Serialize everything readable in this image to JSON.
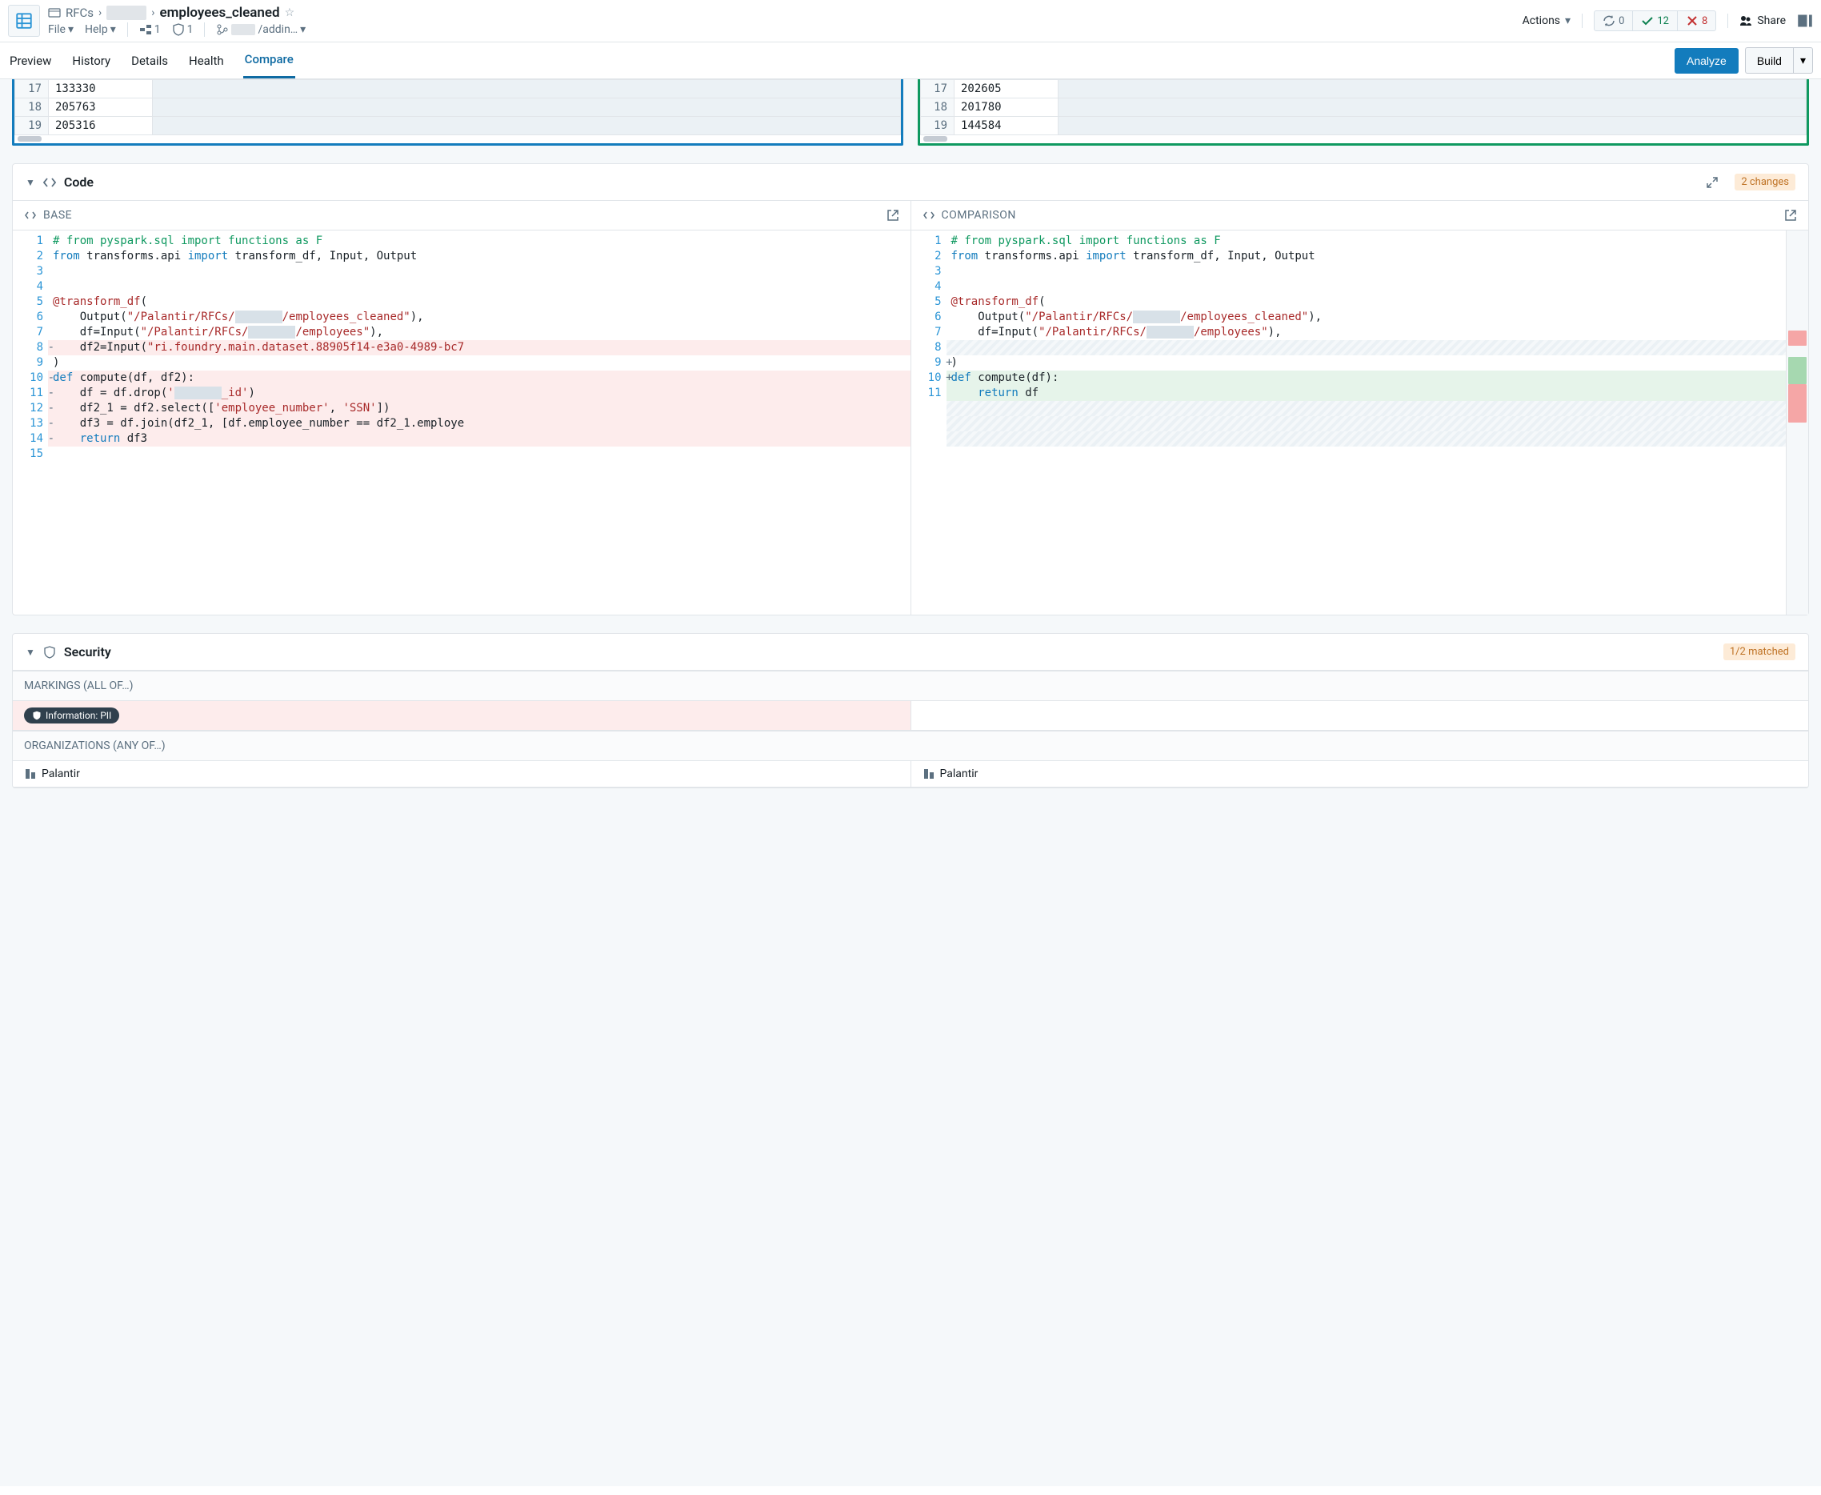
{
  "breadcrumb": {
    "root": "RFCs",
    "title": "employees_cleaned"
  },
  "menu": {
    "file": "File",
    "help": "Help",
    "branches": "1",
    "shield": "1",
    "path": "/addin…"
  },
  "actions_label": "Actions",
  "status": {
    "sync": "0",
    "pass": "12",
    "fail": "8"
  },
  "share": "Share",
  "tabs": {
    "preview": "Preview",
    "history": "History",
    "details": "Details",
    "health": "Health",
    "compare": "Compare"
  },
  "buttons": {
    "analyze": "Analyze",
    "build": "Build"
  },
  "left_table": [
    {
      "n": "17",
      "v": "133330"
    },
    {
      "n": "18",
      "v": "205763"
    },
    {
      "n": "19",
      "v": "205316"
    }
  ],
  "right_table": [
    {
      "n": "17",
      "v": "202605"
    },
    {
      "n": "18",
      "v": "201780"
    },
    {
      "n": "19",
      "v": "144584"
    }
  ],
  "code_card": {
    "title": "Code",
    "badge": "2 changes",
    "base": "BASE",
    "comparison": "COMPARISON"
  },
  "base_gutter": [
    "1",
    "2",
    "3",
    "4",
    "5",
    "6",
    "7",
    "8",
    "9",
    "10",
    "11",
    "12",
    "13",
    "14",
    "15"
  ],
  "base_marks": [
    "",
    "",
    "",
    "",
    "",
    "",
    "",
    "-",
    "",
    "-",
    "-",
    "-",
    "-",
    "-",
    ""
  ],
  "comp_gutter": [
    "1",
    "2",
    "3",
    "4",
    "5",
    "6",
    "7",
    "",
    "8",
    "9",
    "10",
    "",
    "",
    "",
    "11"
  ],
  "comp_marks": [
    "",
    "",
    "",
    "",
    "",
    "",
    "",
    "",
    "",
    "+",
    "+",
    "",
    "",
    "",
    ""
  ],
  "code": {
    "comment": "# from pyspark.sql import functions as F",
    "from": "from",
    "import": "import",
    "transforms_api": " transforms.api ",
    "import_targets": " transform_df, Input, Output",
    "decorator": "@transform_df",
    "lparen": "(",
    "output_pre": "    Output(",
    "path1a": "\"/Palantir/RFCs/",
    "path1b": "/employees_cleaned\"",
    "out_close": "),",
    "dfinput_pre": "    df=Input(",
    "path2b": "/employees\"",
    "in_close": "),",
    "df2input_pre": "    df2=Input(",
    "df2_str": "\"ri.foundry.main.dataset.88905f14-e3a0-4989-bc7",
    "rparen": ")",
    "def": "def",
    "compute2": " compute(df, df2):",
    "compute1": " compute(df):",
    "drop_line": "    df = df.drop('          _id')",
    "select_line": "    df2_1 = df2.select(['employee_number', 'SSN'])",
    "join_line": "    df3 = df.join(df2_1, [df.employee_number == df2_1.employe",
    "return": "return",
    "ret3": " df3",
    "ret1": " df",
    "indent": "    "
  },
  "security": {
    "title": "Security",
    "badge": "1/2 matched",
    "markings": "MARKINGS (ALL OF…)",
    "pii": "Information: PII",
    "orgs": "ORGANIZATIONS (ANY OF…)",
    "org": "Palantir"
  }
}
